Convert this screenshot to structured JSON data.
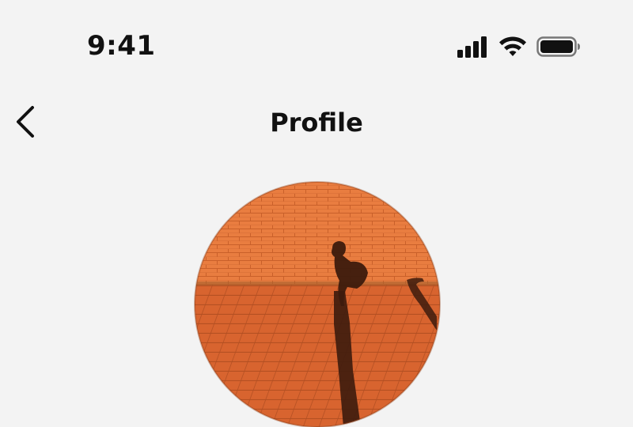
{
  "status_bar": {
    "time": "9:41",
    "icons": [
      "signal-icon",
      "wifi-icon",
      "battery-icon"
    ]
  },
  "nav": {
    "title": "Profile",
    "back_icon": "chevron-left-icon"
  },
  "avatar": {
    "description_icon": "avatar-photo",
    "colors": {
      "wall": "#e87a3e",
      "ground": "#d9652f",
      "shadow": "#3c1a0c"
    }
  },
  "colors": {
    "background": "#f3f3f3",
    "text": "#111111"
  }
}
